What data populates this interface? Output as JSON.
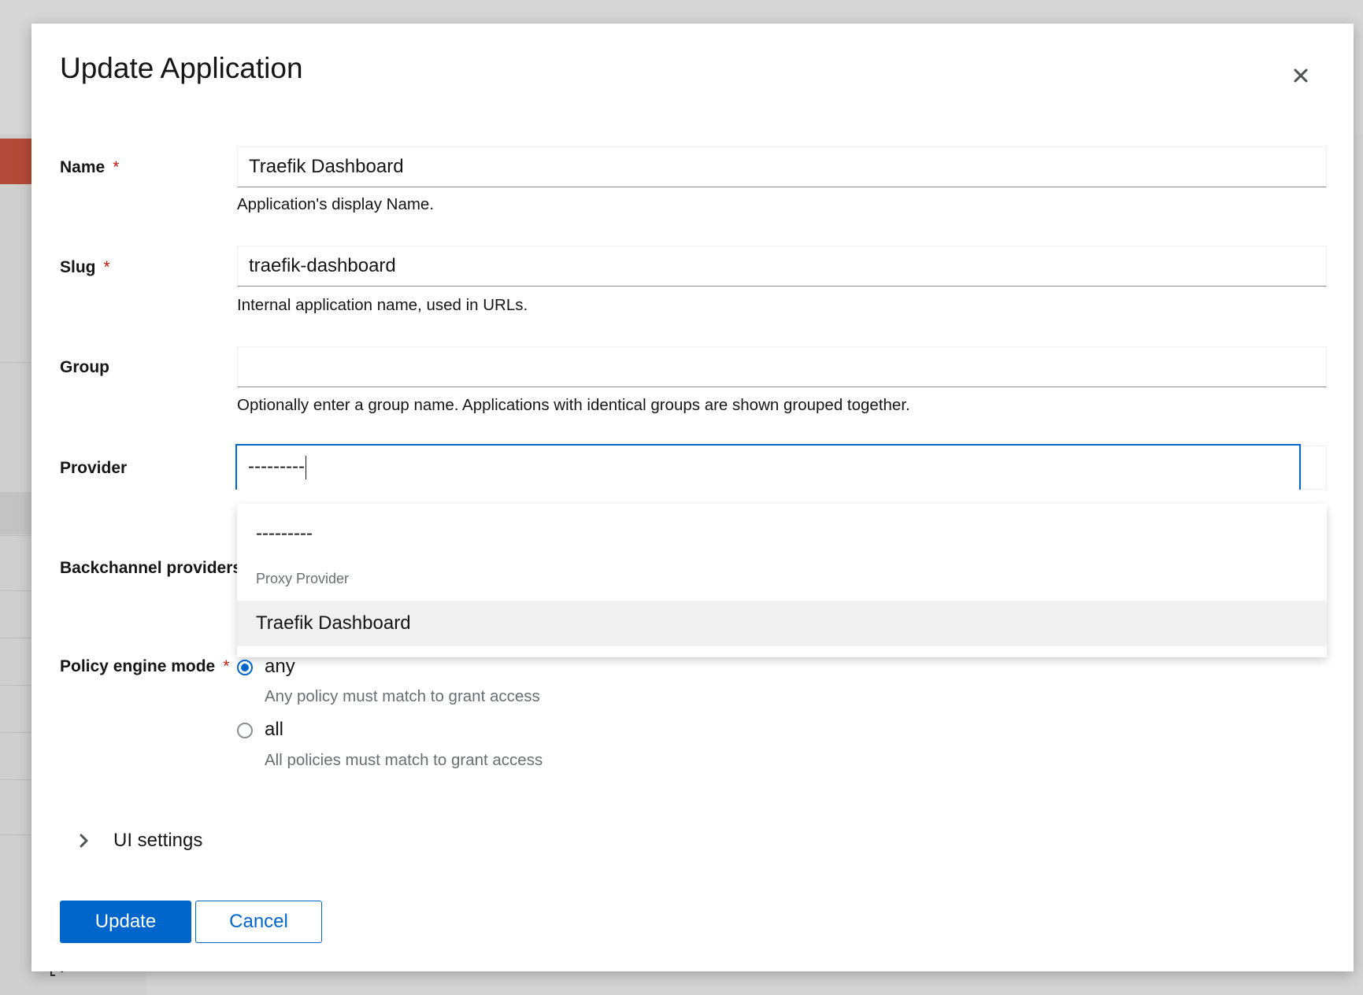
{
  "modal": {
    "title": "Update Application",
    "close_icon": "close-icon"
  },
  "form": {
    "name": {
      "label": "Name",
      "required_marker": "*",
      "value": "Traefik Dashboard",
      "helper": "Application's display Name."
    },
    "slug": {
      "label": "Slug",
      "required_marker": "*",
      "value": "traefik-dashboard",
      "helper": "Internal application name, used in URLs."
    },
    "group": {
      "label": "Group",
      "value": "",
      "helper": "Optionally enter a group name. Applications with identical groups are shown grouped together."
    },
    "provider": {
      "label": "Provider",
      "value": "---------",
      "options": [
        {
          "label": "---------"
        },
        {
          "group_label": "Proxy Provider"
        },
        {
          "label": "Traefik Dashboard",
          "highlighted": true
        }
      ]
    },
    "backchannel": {
      "label": "Backchannel providers"
    },
    "policy_engine_mode": {
      "label": "Policy engine mode",
      "required_marker": "*",
      "options": [
        {
          "label": "any",
          "description": "Any policy must match to grant access",
          "checked": true
        },
        {
          "label": "all",
          "description": "All policies must match to grant access",
          "checked": false
        }
      ]
    },
    "ui_settings": {
      "label": "UI settings",
      "icon": "chevron-right-icon"
    }
  },
  "actions": {
    "update_label": "Update",
    "cancel_label": "Cancel"
  },
  "colors": {
    "primary": "#0066cc",
    "required": "#c9190b",
    "muted_text": "#6a6e73"
  }
}
